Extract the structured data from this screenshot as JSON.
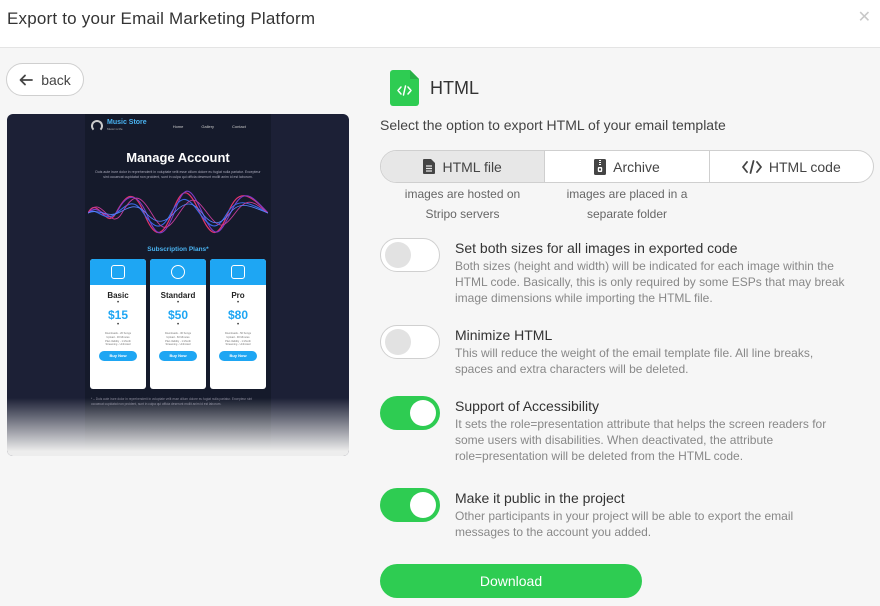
{
  "header": {
    "title": "Export to your Email Marketing Platform",
    "close_icon": "close-icon"
  },
  "back": {
    "label": "back",
    "icon": "arrow-left-icon"
  },
  "preview": {
    "brand": "Music Store",
    "tagline": "Music is life",
    "nav": [
      "Home",
      "Gallery",
      "Contact"
    ],
    "heading": "Manage Account",
    "intro": "Duis aute irure dolor in reprehenderit in voluptate velit esse cillum dolore eu fugiat nulla pariatur. Excepteur sint occaecat cupidatat non proident, sunt in culpa qui officia deserunt mollit anim id est laborum.",
    "plans_title": "Subscription Plans*",
    "plans": [
      {
        "name": "Basic",
        "price": "$15",
        "lines": [
          "Downloads - 20 Songs",
          "Upload - 30 Minutes",
          "Plan Validity - 1 Month",
          "Streaming - Unlimited"
        ],
        "button": "Buy Now"
      },
      {
        "name": "Standard",
        "price": "$50",
        "lines": [
          "Downloads - 30 Songs",
          "Upload - 60 Minutes",
          "Plan Validity - 1 Month",
          "Streaming - Unlimited"
        ],
        "button": "Buy Now"
      },
      {
        "name": "Pro",
        "price": "$80",
        "lines": [
          "Downloads - 50 Songs",
          "Upload - 90 Minutes",
          "Plan Validity - 1 Month",
          "Streaming - Unlimited"
        ],
        "button": "Buy Now"
      }
    ],
    "footnote": "* – Duis aute irure dolor in reprehenderit in voluptate velit esse cillum dolore eu fugiat nulla pariatur. Excepteur sint occaecat cupidatat non proident, sunt in culpa qui officia deserunt mollit anim id est laborum."
  },
  "format": {
    "title": "HTML",
    "icon": "html-file-icon",
    "icon_color": "#2ecc52"
  },
  "subtitle": "Select the option to export HTML of your email template",
  "export_options": [
    {
      "label": "HTML file",
      "icon": "document-icon",
      "active": true
    },
    {
      "label": "Archive",
      "icon": "zip-icon",
      "active": false
    },
    {
      "label": "HTML code",
      "icon": "code-icon",
      "active": false
    }
  ],
  "hints": {
    "html_file": [
      "images are hosted on",
      "Stripo servers"
    ],
    "archive": [
      "images are placed in a",
      "separate folder"
    ]
  },
  "settings": [
    {
      "title": "Set both sizes for all images in exported code",
      "desc": "Both sizes (height and width) will be indicated for each image within the HTML code. Basically, this is only required by some ESPs that may break image dimensions while importing the HTML file.",
      "on": false
    },
    {
      "title": "Minimize HTML",
      "desc": "This will reduce the weight of the email template file. All line breaks, spaces and extra characters will be deleted.",
      "on": false
    },
    {
      "title": "Support of Accessibility",
      "desc": "It sets the role=presentation attribute that helps the screen readers for some users with disabilities. When deactivated, the attribute role=presentation will be deleted from the HTML code.",
      "on": true
    },
    {
      "title": "Make it public in the project",
      "desc": "Other participants in your project will be able to export the email messages to the account you added.",
      "on": true
    }
  ],
  "download": {
    "label": "Download"
  },
  "colors": {
    "accent": "#2ecc52",
    "preview_bg": "#151a2b",
    "plan_blue": "#1ea6f3"
  }
}
